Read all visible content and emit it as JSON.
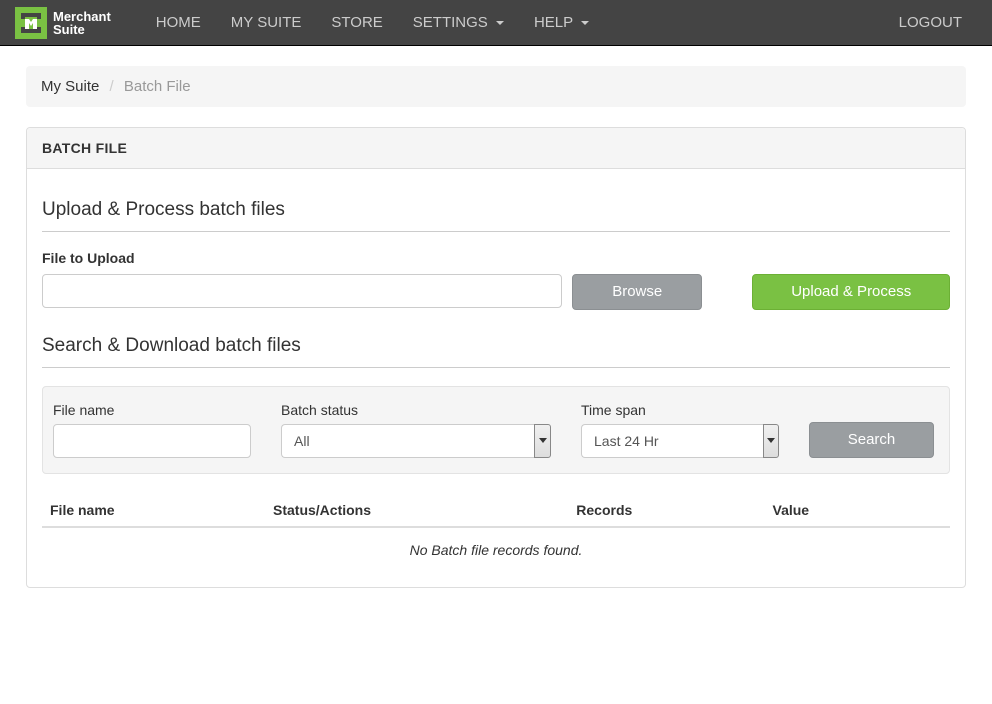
{
  "brand": {
    "line1": "Merchant",
    "line2": "Suite"
  },
  "nav": {
    "home": "HOME",
    "mysuite": "MY SUITE",
    "store": "STORE",
    "settings": "SETTINGS",
    "help": "HELP",
    "logout": "LOGOUT"
  },
  "breadcrumb": {
    "parent": "My Suite",
    "current": "Batch File"
  },
  "panel_title": "BATCH FILE",
  "upload": {
    "section_title": "Upload & Process batch files",
    "file_label": "File to Upload",
    "browse_label": "Browse",
    "process_label": "Upload & Process"
  },
  "search": {
    "section_title": "Search & Download batch files",
    "filename_label": "File name",
    "status_label": "Batch status",
    "status_value": "All",
    "timespan_label": "Time span",
    "timespan_value": "Last 24 Hr",
    "search_label": "Search"
  },
  "table": {
    "col_filename": "File name",
    "col_status": "Status/Actions",
    "col_records": "Records",
    "col_value": "Value",
    "empty": "No Batch file records found."
  }
}
